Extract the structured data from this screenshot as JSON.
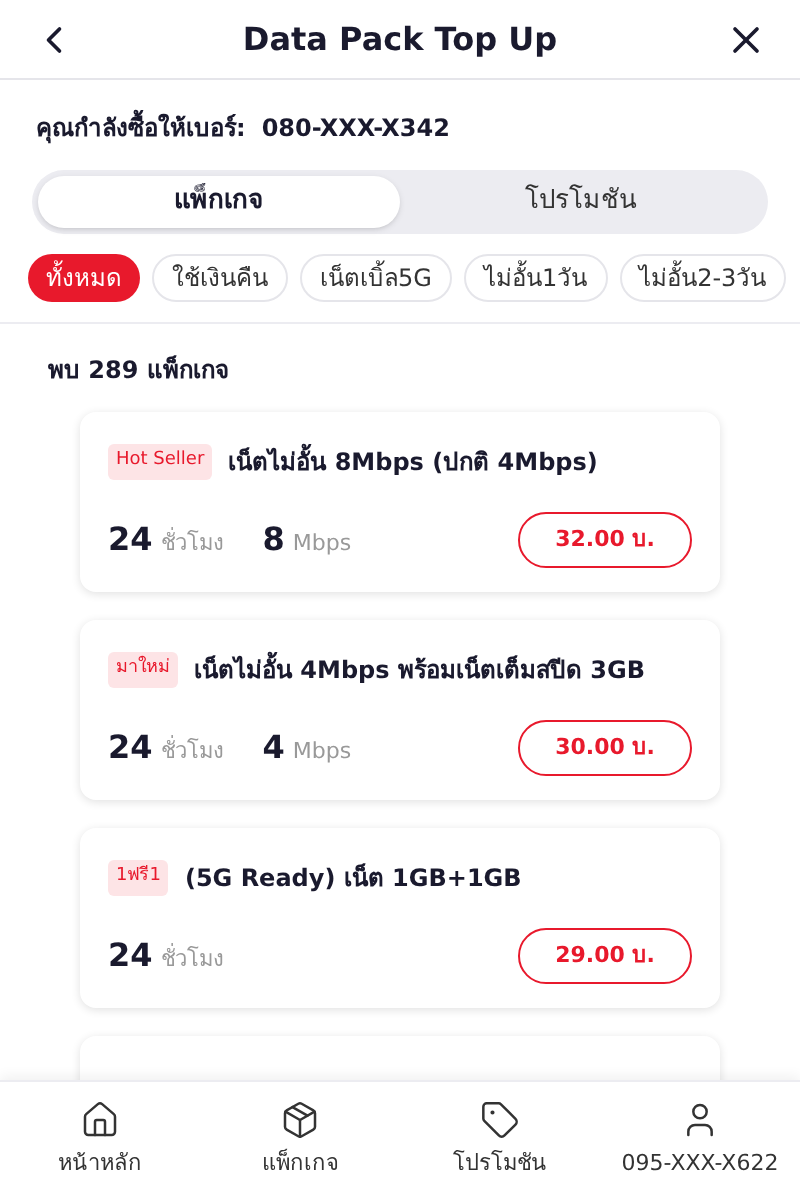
{
  "header": {
    "title": "Data Pack Top Up"
  },
  "buyer": {
    "label": "คุณกำลังซื้อให้เบอร์:",
    "number": "080-XXX-X342"
  },
  "tabs": [
    {
      "label": "แพ็กเกจ",
      "selected": true
    },
    {
      "label": "โปรโมชัน",
      "selected": false
    }
  ],
  "filters": [
    {
      "label": "ทั้งหมด",
      "selected": true
    },
    {
      "label": "ใช้เงินคืน",
      "selected": false
    },
    {
      "label": "เน็ตเบิ้ล5G",
      "selected": false
    },
    {
      "label": "ไม่อั้น1วัน",
      "selected": false
    },
    {
      "label": "ไม่อั้น2-3วัน",
      "selected": false
    }
  ],
  "result_count": "พบ 289 แพ็กเกจ",
  "packages": [
    {
      "badge": "Hot Seller",
      "name": "เน็ตไม่อั้น 8Mbps (ปกติ 4Mbps)",
      "specs": [
        {
          "value": "24",
          "unit": "ชั่วโมง"
        },
        {
          "value": "8",
          "unit": "Mbps"
        }
      ],
      "price": "32.00 บ."
    },
    {
      "badge": "มาใหม่",
      "name": "เน็ตไม่อั้น 4Mbps พร้อมเน็ตเต็มสปีด 3GB",
      "specs": [
        {
          "value": "24",
          "unit": "ชั่วโมง"
        },
        {
          "value": "4",
          "unit": "Mbps"
        }
      ],
      "price": "30.00 บ."
    },
    {
      "badge": "1ฟรี1",
      "name": "(5G Ready) เน็ต 1GB+1GB",
      "specs": [
        {
          "value": "24",
          "unit": "ชั่วโมง"
        }
      ],
      "price": "29.00 บ."
    }
  ],
  "bottom_nav": [
    {
      "kind": "home",
      "label": "หน้าหลัก"
    },
    {
      "kind": "package",
      "label": "แพ็กเกจ"
    },
    {
      "kind": "tag",
      "label": "โปรโมชัน"
    },
    {
      "kind": "user",
      "label": "095-XXX-X622"
    }
  ]
}
